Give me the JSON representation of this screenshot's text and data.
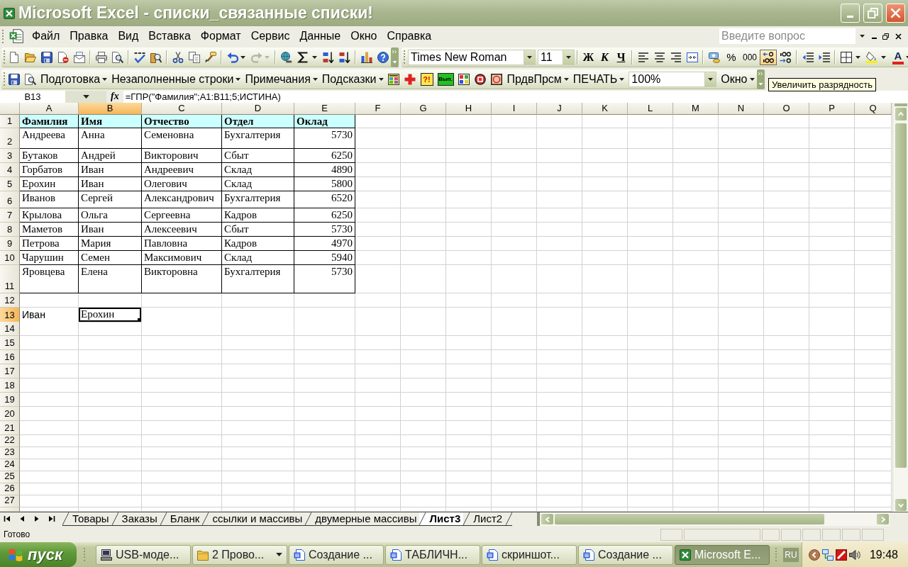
{
  "window": {
    "title": "Microsoft Excel - списки_связанные списки!"
  },
  "menu_bar": {
    "items": [
      {
        "label": "Файл"
      },
      {
        "label": "Правка"
      },
      {
        "label": "Вид"
      },
      {
        "label": "Вставка"
      },
      {
        "label": "Формат"
      },
      {
        "label": "Сервис"
      },
      {
        "label": "Данные"
      },
      {
        "label": "Окно"
      },
      {
        "label": "Справка"
      }
    ],
    "help_search": {
      "placeholder": "Введите вопрос"
    }
  },
  "standard_toolbar": {
    "history_buttons": [
      {
        "kind": "undo",
        "disabled": false
      },
      {
        "kind": "redo",
        "disabled": true
      }
    ]
  },
  "formatting_toolbar": {
    "font_name": "Times New Roman",
    "font_size": "11",
    "style_buttons": [
      {
        "kind": "bold",
        "label": "Ж"
      },
      {
        "kind": "italic",
        "label": "К"
      },
      {
        "kind": "underline",
        "label": "Ч"
      }
    ],
    "number_buttons": [
      {
        "kind": "currency",
        "hovered": false
      },
      {
        "kind": "percent",
        "label": "%",
        "hovered": false
      },
      {
        "kind": "thousands",
        "label": "000",
        "hovered": false
      },
      {
        "kind": "increase_decimal",
        "hovered": true
      },
      {
        "kind": "decrease_decimal",
        "hovered": false
      }
    ],
    "font_color": {
      "label": "A"
    }
  },
  "custom_toolbar": {
    "items": [
      {
        "kind": "menu",
        "label": "Подготовка"
      },
      {
        "kind": "menu",
        "label": "Незаполненные строки"
      },
      {
        "kind": "menu",
        "label": "Примечания"
      },
      {
        "kind": "menu",
        "label": "Подсказки"
      },
      {
        "kind": "macro_grid"
      },
      {
        "kind": "macro_cross"
      },
      {
        "kind": "macro_tile",
        "label": "?!"
      },
      {
        "kind": "macro_badge",
        "label": "Вып."
      },
      {
        "kind": "macro_palette"
      },
      {
        "kind": "macro_stop"
      },
      {
        "kind": "macro_ring"
      },
      {
        "kind": "menu",
        "label": "ПрдвПрсм"
      },
      {
        "kind": "menu",
        "label": "ПЕЧАТЬ"
      },
      {
        "kind": "zoom",
        "value": "100%"
      },
      {
        "kind": "menu",
        "label": "Окно"
      }
    ]
  },
  "tooltip": {
    "text": "Увеличить разрядность"
  },
  "formula_bar": {
    "name_box": "B13",
    "function_label": "fx",
    "formula": "=ГПР(\"Фамилия\";A1:B11;5;ИСТИНА)"
  },
  "grid": {
    "columns": [
      {
        "label": "A",
        "selected": false
      },
      {
        "label": "B",
        "selected": true
      },
      {
        "label": "C",
        "selected": false
      },
      {
        "label": "D",
        "selected": false
      },
      {
        "label": "E",
        "selected": false
      },
      {
        "label": "F",
        "selected": false
      },
      {
        "label": "G",
        "selected": false
      },
      {
        "label": "H",
        "selected": false
      },
      {
        "label": "I",
        "selected": false
      },
      {
        "label": "J",
        "selected": false
      },
      {
        "label": "K",
        "selected": false
      },
      {
        "label": "L",
        "selected": false
      },
      {
        "label": "M",
        "selected": false
      },
      {
        "label": "N",
        "selected": false
      },
      {
        "label": "O",
        "selected": false
      },
      {
        "label": "P",
        "selected": false
      },
      {
        "label": "Q",
        "selected": false
      }
    ],
    "rows": [
      {
        "label": "1",
        "selected": false,
        "kind": "header",
        "cells": [
          {
            "value": "Фамилия",
            "kind": "text",
            "selected": false
          },
          {
            "value": "Имя",
            "kind": "text",
            "selected": false
          },
          {
            "value": "Отчество",
            "kind": "text",
            "selected": false
          },
          {
            "value": "Отдел",
            "kind": "text",
            "selected": false
          },
          {
            "value": "Оклад",
            "kind": "text",
            "selected": false
          }
        ]
      },
      {
        "label": "2",
        "selected": false,
        "kind": "record",
        "cells": [
          {
            "value": "Андреева",
            "kind": "text",
            "selected": false
          },
          {
            "value": "Анна",
            "kind": "text",
            "selected": false
          },
          {
            "value": "Семеновна",
            "kind": "text",
            "selected": false
          },
          {
            "value": "Бухгалтерия",
            "kind": "text",
            "selected": false
          },
          {
            "value": "5730",
            "kind": "number",
            "selected": false
          }
        ]
      },
      {
        "label": "3",
        "selected": false,
        "kind": "record",
        "cells": [
          {
            "value": "Бутаков",
            "kind": "text",
            "selected": false
          },
          {
            "value": "Андрей",
            "kind": "text",
            "selected": false
          },
          {
            "value": "Викторович",
            "kind": "text",
            "selected": false
          },
          {
            "value": "Сбыт",
            "kind": "text",
            "selected": false
          },
          {
            "value": "6250",
            "kind": "number",
            "selected": false
          }
        ]
      },
      {
        "label": "4",
        "selected": false,
        "kind": "record",
        "cells": [
          {
            "value": "Горбатов",
            "kind": "text",
            "selected": false
          },
          {
            "value": "Иван",
            "kind": "text",
            "selected": false
          },
          {
            "value": "Андреевич",
            "kind": "text",
            "selected": false
          },
          {
            "value": "Склад",
            "kind": "text",
            "selected": false
          },
          {
            "value": "4890",
            "kind": "number",
            "selected": false
          }
        ]
      },
      {
        "label": "5",
        "selected": false,
        "kind": "record",
        "cells": [
          {
            "value": "Ерохин",
            "kind": "text",
            "selected": false
          },
          {
            "value": "Иван",
            "kind": "text",
            "selected": false
          },
          {
            "value": "Олегович",
            "kind": "text",
            "selected": false
          },
          {
            "value": "Склад",
            "kind": "text",
            "selected": false
          },
          {
            "value": "5800",
            "kind": "number",
            "selected": false
          }
        ]
      },
      {
        "label": "6",
        "selected": false,
        "kind": "record",
        "cells": [
          {
            "value": "Иванов",
            "kind": "text",
            "selected": false
          },
          {
            "value": "Сергей",
            "kind": "text",
            "selected": false
          },
          {
            "value": "Александрович",
            "kind": "text",
            "selected": false
          },
          {
            "value": "Бухгалтерия",
            "kind": "text",
            "selected": false
          },
          {
            "value": "6520",
            "kind": "number",
            "selected": false
          }
        ]
      },
      {
        "label": "7",
        "selected": false,
        "kind": "record",
        "cells": [
          {
            "value": "Крылова",
            "kind": "text",
            "selected": false
          },
          {
            "value": "Ольга",
            "kind": "text",
            "selected": false
          },
          {
            "value": "Сергеевна",
            "kind": "text",
            "selected": false
          },
          {
            "value": "Кадров",
            "kind": "text",
            "selected": false
          },
          {
            "value": "6250",
            "kind": "number",
            "selected": false
          }
        ]
      },
      {
        "label": "8",
        "selected": false,
        "kind": "record",
        "cells": [
          {
            "value": "Маметов",
            "kind": "text",
            "selected": false
          },
          {
            "value": "Иван",
            "kind": "text",
            "selected": false
          },
          {
            "value": "Алексеевич",
            "kind": "text",
            "selected": false
          },
          {
            "value": "Сбыт",
            "kind": "text",
            "selected": false
          },
          {
            "value": "5730",
            "kind": "number",
            "selected": false
          }
        ]
      },
      {
        "label": "9",
        "selected": false,
        "kind": "record",
        "cells": [
          {
            "value": "Петрова",
            "kind": "text",
            "selected": false
          },
          {
            "value": "Мария",
            "kind": "text",
            "selected": false
          },
          {
            "value": "Павловна",
            "kind": "text",
            "selected": false
          },
          {
            "value": "Кадров",
            "kind": "text",
            "selected": false
          },
          {
            "value": "4970",
            "kind": "number",
            "selected": false
          }
        ]
      },
      {
        "label": "10",
        "selected": false,
        "kind": "record",
        "cells": [
          {
            "value": "Чарушин",
            "kind": "text",
            "selected": false
          },
          {
            "value": "Семен",
            "kind": "text",
            "selected": false
          },
          {
            "value": "Максимович",
            "kind": "text",
            "selected": false
          },
          {
            "value": "Склад",
            "kind": "text",
            "selected": false
          },
          {
            "value": "5940",
            "kind": "number",
            "selected": false
          }
        ]
      },
      {
        "label": "11",
        "selected": false,
        "kind": "record",
        "cells": [
          {
            "value": "Яровцева",
            "kind": "text",
            "selected": false
          },
          {
            "value": "Елена",
            "kind": "text",
            "selected": false
          },
          {
            "value": "Викторовна",
            "kind": "text",
            "selected": false
          },
          {
            "value": "Бухгалтерия",
            "kind": "text",
            "selected": false
          },
          {
            "value": "5730",
            "kind": "number",
            "selected": false
          }
        ]
      },
      {
        "label": "12",
        "selected": false,
        "kind": "blank"
      },
      {
        "label": "13",
        "selected": true,
        "kind": "plain",
        "cells": [
          {
            "value": "Иван",
            "kind": "general",
            "selected": false
          },
          {
            "value": "Ерохин",
            "kind": "text",
            "selected": true
          }
        ]
      },
      {
        "label": "14",
        "selected": false,
        "kind": "blank"
      },
      {
        "label": "15",
        "selected": false,
        "kind": "blank"
      },
      {
        "label": "16",
        "selected": false,
        "kind": "blank"
      },
      {
        "label": "17",
        "selected": false,
        "kind": "blank"
      },
      {
        "label": "18",
        "selected": false,
        "kind": "blank"
      },
      {
        "label": "19",
        "selected": false,
        "kind": "blank"
      },
      {
        "label": "20",
        "selected": false,
        "kind": "blank"
      },
      {
        "label": "21",
        "selected": false,
        "kind": "blank"
      },
      {
        "label": "22",
        "selected": false,
        "kind": "blank"
      },
      {
        "label": "23",
        "selected": false,
        "kind": "blank"
      },
      {
        "label": "24",
        "selected": false,
        "kind": "blank"
      },
      {
        "label": "25",
        "selected": false,
        "kind": "blank"
      },
      {
        "label": "26",
        "selected": false,
        "kind": "blank"
      },
      {
        "label": "27",
        "selected": false,
        "kind": "blank"
      }
    ]
  },
  "sheet_tabs": [
    {
      "label": "Товары",
      "selected": false
    },
    {
      "label": "Заказы",
      "selected": false
    },
    {
      "label": "Бланк",
      "selected": false
    },
    {
      "label": "ссылки и массивы",
      "selected": false
    },
    {
      "label": "двумерные массивы",
      "selected": false
    },
    {
      "label": "Лист3",
      "selected": true
    },
    {
      "label": "Лист2",
      "selected": false
    }
  ],
  "status_bar": {
    "text": "Готово"
  },
  "taskbar": {
    "start_label": "пуск",
    "tasks": [
      {
        "kind": "device",
        "label": "USB-моде...",
        "grouped": false,
        "selected": false
      },
      {
        "kind": "folder",
        "label": "2 Прово...",
        "grouped": true,
        "selected": false
      },
      {
        "kind": "document",
        "label": "Создание ...",
        "grouped": false,
        "selected": false
      },
      {
        "kind": "document",
        "label": "ТАБЛИЧН...",
        "grouped": false,
        "selected": false
      },
      {
        "kind": "document",
        "label": "скриншот...",
        "grouped": false,
        "selected": false
      },
      {
        "kind": "document",
        "label": "Создание ...",
        "grouped": false,
        "selected": false
      },
      {
        "kind": "spreadsheet",
        "label": "Microsoft E...",
        "grouped": false,
        "selected": true
      }
    ],
    "language": "RU",
    "clock": "19:48"
  }
}
